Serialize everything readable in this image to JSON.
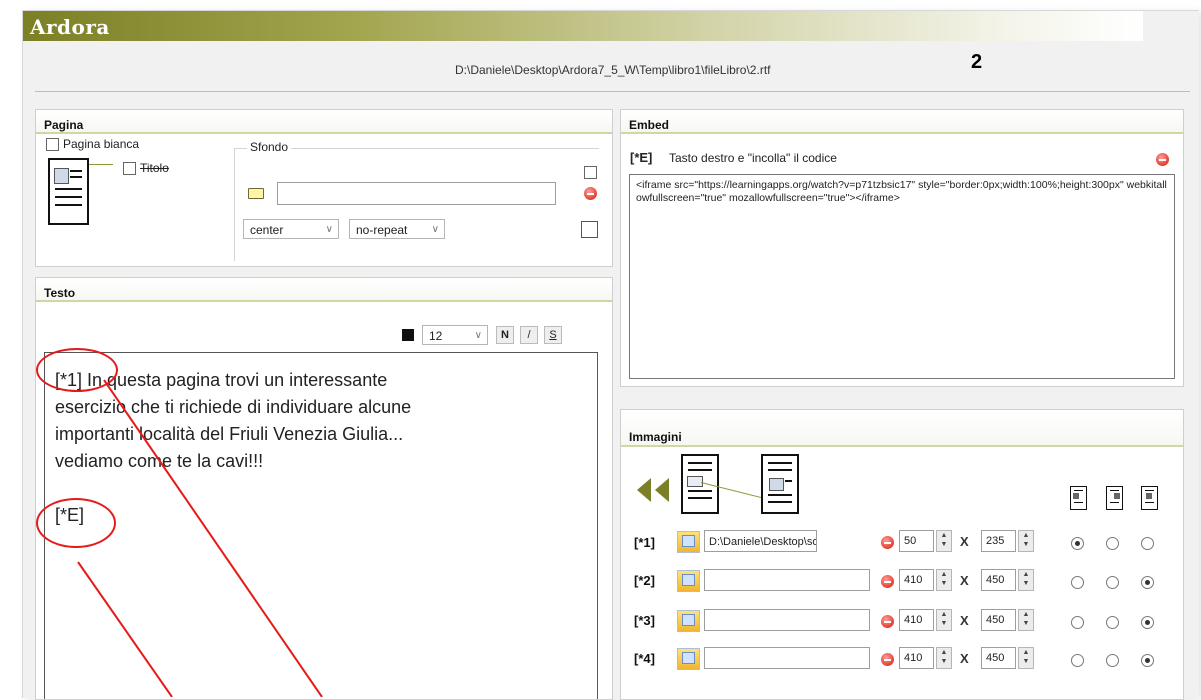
{
  "app": {
    "title": "Ardora",
    "file_path": "D:\\Daniele\\Desktop\\Ardora7_5_W\\Temp\\libro1\\fileLibro\\2.rtf",
    "page_number": "2"
  },
  "pagina": {
    "header": "Pagina",
    "blank_page_label": "Pagina bianca",
    "title_label": "Titolo",
    "background_label": "Sfondo",
    "bg_position": "center",
    "bg_repeat": "no-repeat",
    "bg_file_value": ""
  },
  "testo": {
    "header": "Testo",
    "font_size": "12",
    "bold_label": "N",
    "italic_label": "/",
    "strike_label": "S",
    "content_lines": [
      "[*1] In questa pagina trovi un interessante",
      "esercizio che ti richiede di individuare alcune",
      "importanti località del Friuli Venezia Giulia...",
      "vediamo come te la cavi!!!"
    ],
    "embed_marker": "[*E]"
  },
  "embed": {
    "header": "Embed",
    "marker": "[*E]",
    "hint": "Tasto destro e \"incolla\" il codice",
    "code": "<iframe src=\"https://learningapps.org/watch?v=p71tzbsic17\" style=\"border:0px;width:100%;height:300px\" webkitallowfullscreen=\"true\" mozallowfullscreen=\"true\"></iframe>"
  },
  "immagini": {
    "header": "Immagini",
    "rows": [
      {
        "label": "[*1]",
        "path": "D:\\Daniele\\Desktop\\softv",
        "width": "50",
        "height": "235",
        "align": "left"
      },
      {
        "label": "[*2]",
        "path": "",
        "width": "410",
        "height": "450",
        "align": "right"
      },
      {
        "label": "[*3]",
        "path": "",
        "width": "410",
        "height": "450",
        "align": "right"
      },
      {
        "label": "[*4]",
        "path": "",
        "width": "410",
        "height": "450",
        "align": "right"
      }
    ],
    "times_sign": "X"
  },
  "colors": {
    "title_bar_start": "#7b7f25",
    "header_underline": "#cfd7a5",
    "annotation_red": "#e51a1a"
  }
}
